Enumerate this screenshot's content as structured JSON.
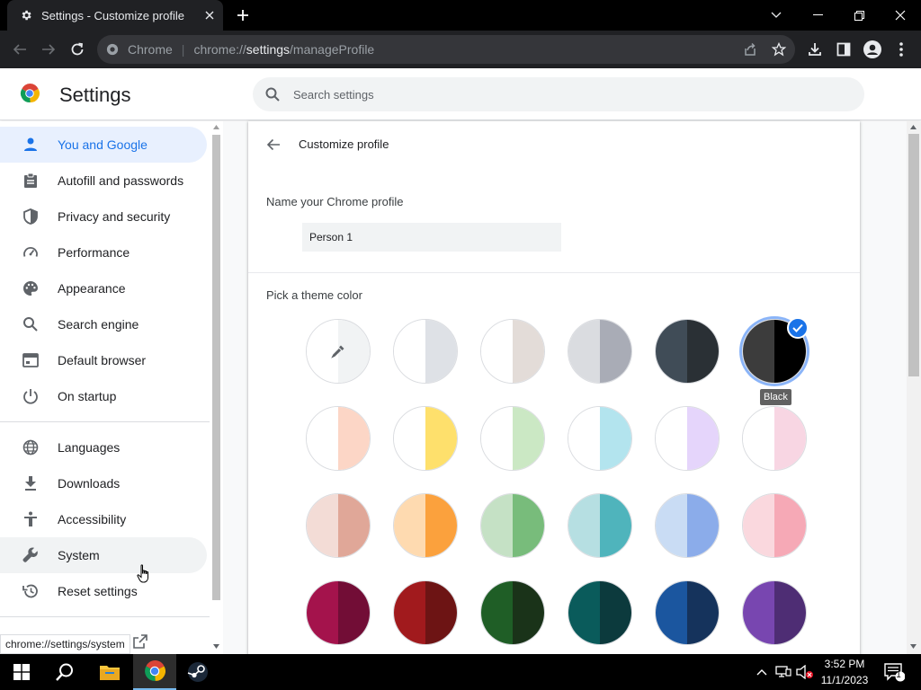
{
  "browser": {
    "tab_title": "Settings - Customize profile",
    "omnibox_site": "Chrome",
    "url_scheme": "chrome://",
    "url_host": "settings",
    "url_path": "/manageProfile"
  },
  "header": {
    "title": "Settings",
    "search_placeholder": "Search settings"
  },
  "sidebar": {
    "items": [
      {
        "label": "You and Google",
        "icon": "person-icon"
      },
      {
        "label": "Autofill and passwords",
        "icon": "clipboard-icon"
      },
      {
        "label": "Privacy and security",
        "icon": "shield-icon"
      },
      {
        "label": "Performance",
        "icon": "speedometer-icon"
      },
      {
        "label": "Appearance",
        "icon": "palette-icon"
      },
      {
        "label": "Search engine",
        "icon": "search-icon"
      },
      {
        "label": "Default browser",
        "icon": "browser-icon"
      },
      {
        "label": "On startup",
        "icon": "power-icon"
      },
      {
        "label": "Languages",
        "icon": "globe-icon"
      },
      {
        "label": "Downloads",
        "icon": "download-icon"
      },
      {
        "label": "Accessibility",
        "icon": "accessibility-icon"
      },
      {
        "label": "System",
        "icon": "wrench-icon"
      },
      {
        "label": "Reset settings",
        "icon": "restore-icon"
      }
    ]
  },
  "main": {
    "title": "Customize profile",
    "name_label": "Name your Chrome profile",
    "name_value": "Person 1",
    "pick_label": "Pick a theme color",
    "selected_tooltip": "Black",
    "swatches": [
      {
        "left": "#ffffff",
        "right": "#f1f3f4",
        "custom": true
      },
      {
        "left": "#ffffff",
        "right": "#dee1e6"
      },
      {
        "left": "#ffffff",
        "right": "#e3dcd8"
      },
      {
        "left": "#dadce0",
        "right": "#a9acb6"
      },
      {
        "left": "#404c57",
        "right": "#2a3035"
      },
      {
        "left": "#3c3c3c",
        "right": "#000000",
        "selected": true
      },
      {
        "left": "#ffffff",
        "right": "#fcd6c6"
      },
      {
        "left": "#ffffff",
        "right": "#fee06c"
      },
      {
        "left": "#ffffff",
        "right": "#cbe8c4"
      },
      {
        "left": "#ffffff",
        "right": "#b3e4ee"
      },
      {
        "left": "#ffffff",
        "right": "#e5d5fb"
      },
      {
        "left": "#ffffff",
        "right": "#f8d6e3"
      },
      {
        "left": "#f3dcd6",
        "right": "#e0a798"
      },
      {
        "left": "#fedab0",
        "right": "#fba13d"
      },
      {
        "left": "#c5e1c5",
        "right": "#78bc7b"
      },
      {
        "left": "#b6dfe2",
        "right": "#4fb4bc"
      },
      {
        "left": "#c9dcf4",
        "right": "#8bacea"
      },
      {
        "left": "#fad8de",
        "right": "#f6a9b6"
      },
      {
        "left": "#a4134c",
        "right": "#720d36"
      },
      {
        "left": "#a11a1d",
        "right": "#6d1414"
      },
      {
        "left": "#1f5e26",
        "right": "#1a3319"
      },
      {
        "left": "#0a5b5b",
        "right": "#0c3a3d"
      },
      {
        "left": "#1b569f",
        "right": "#15335c"
      },
      {
        "left": "#7846b0",
        "right": "#4e2d74"
      }
    ]
  },
  "status_url": "chrome://settings/system",
  "taskbar": {
    "time": "3:52 PM",
    "date": "11/1/2023",
    "notification_count": "1"
  },
  "colors": {
    "accent": "#1a73e8",
    "active_bg": "#e8f0fe",
    "chrome_dark": "#202124"
  }
}
